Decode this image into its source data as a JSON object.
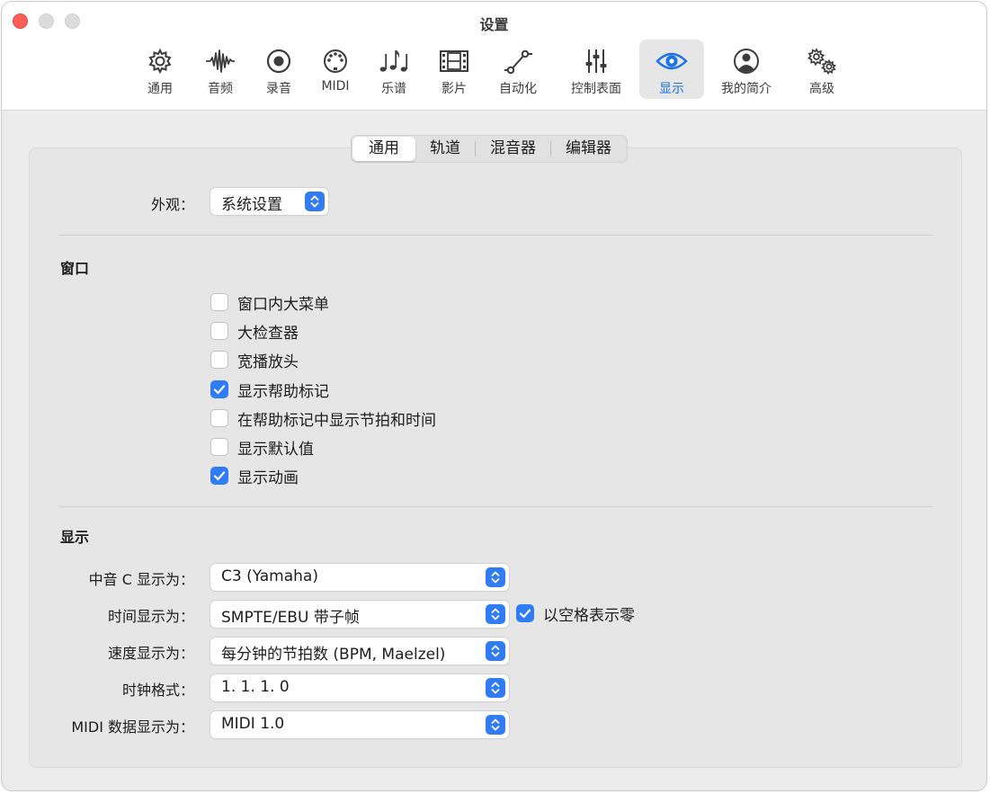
{
  "window": {
    "title": "设置"
  },
  "toolbar": {
    "items": [
      {
        "label": "通用",
        "icon": "gear-icon"
      },
      {
        "label": "音频",
        "icon": "waveform-icon"
      },
      {
        "label": "录音",
        "icon": "record-icon"
      },
      {
        "label": "MIDI",
        "icon": "midi-icon"
      },
      {
        "label": "乐谱",
        "icon": "music-notes-icon"
      },
      {
        "label": "影片",
        "icon": "film-icon"
      },
      {
        "label": "自动化",
        "icon": "automation-icon"
      },
      {
        "label": "控制表面",
        "icon": "sliders-icon"
      },
      {
        "label": "显示",
        "icon": "eye-icon"
      },
      {
        "label": "我的简介",
        "icon": "person-icon"
      },
      {
        "label": "高级",
        "icon": "gears-icon"
      }
    ],
    "active": "显示"
  },
  "tabs": {
    "items": [
      "通用",
      "轨道",
      "混音器",
      "编辑器"
    ],
    "active": "通用"
  },
  "appearance": {
    "label": "外观：",
    "value": "系统设置"
  },
  "window_section": {
    "title": "窗口",
    "checkboxes": [
      {
        "label": "窗口内大菜单",
        "checked": false
      },
      {
        "label": "大检查器",
        "checked": false
      },
      {
        "label": "宽播放头",
        "checked": false
      },
      {
        "label": "显示帮助标记",
        "checked": true
      },
      {
        "label": "在帮助标记中显示节拍和时间",
        "checked": false
      },
      {
        "label": "显示默认值",
        "checked": false
      },
      {
        "label": "显示动画",
        "checked": true
      }
    ]
  },
  "display_section": {
    "title": "显示",
    "rows": [
      {
        "label": "中音 C 显示为：",
        "value": "C3 (Yamaha)"
      },
      {
        "label": "时间显示为：",
        "value": "SMPTE/EBU 带子帧"
      },
      {
        "label": "速度显示为：",
        "value": "每分钟的节拍数 (BPM, Maelzel)"
      },
      {
        "label": "时钟格式：",
        "value": "1. 1. 1. 0"
      },
      {
        "label": "MIDI 数据显示为：",
        "value": "MIDI 1.0"
      }
    ],
    "space_zero": {
      "label": "以空格表示零",
      "checked": true
    }
  },
  "colors": {
    "accent": "#2f7cf6",
    "active_label": "#1a73e8"
  }
}
